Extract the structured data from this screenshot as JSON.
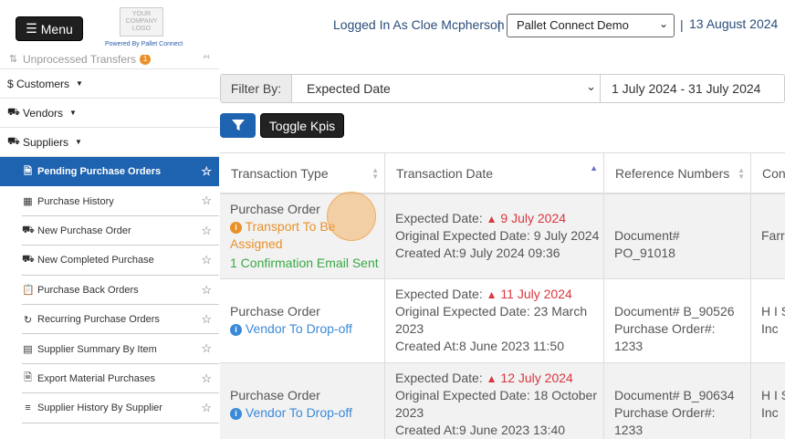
{
  "header": {
    "menu_label": "Menu",
    "logo_text": "YOUR COMPANY LOGO",
    "powered_by": "Powered By Pallet Connect",
    "logged_in": "Logged In As Cloe Mcpherson",
    "org_selected": "Pallet Connect Demo",
    "current_date": "13 August 2024"
  },
  "sidebar": {
    "top_partial": "Unprocessed Transfers",
    "top_badge": "1",
    "customers": "$ Customers",
    "vendors": "Vendors",
    "suppliers": "Suppliers",
    "items": [
      {
        "label": "Pending Purchase Orders",
        "icon": "file-icon",
        "active": true
      },
      {
        "label": "Purchase History",
        "icon": "table-icon"
      },
      {
        "label": "New Purchase Order",
        "icon": "truck-loading-icon"
      },
      {
        "label": "New Completed Purchase",
        "icon": "truck-icon"
      },
      {
        "label": "Purchase Back Orders",
        "icon": "clipboard-icon"
      },
      {
        "label": "Recurring Purchase Orders",
        "icon": "recycle-icon"
      },
      {
        "label": "Supplier Summary By Item",
        "icon": "pallet-icon"
      },
      {
        "label": "Export Material Purchases",
        "icon": "file-export-icon"
      },
      {
        "label": "Supplier History By Supplier",
        "icon": "chart-icon"
      }
    ]
  },
  "filter": {
    "label": "Filter By:",
    "selected": "Expected Date",
    "range": "1 July 2024 - 31 July 2024"
  },
  "toolbar": {
    "kpis_label": "Toggle Kpis"
  },
  "table": {
    "headers": [
      "Transaction Type",
      "Transaction Date",
      "Reference Numbers",
      "Cont"
    ],
    "rows": [
      {
        "type": "Purchase Order",
        "status": "Transport To Be",
        "status2": "Assigned",
        "extra": "1 Confirmation Email Sent",
        "expected_label": "Expected Date:",
        "expected": "9 July 2024",
        "original": "Original Expected Date: 9 July 2024",
        "original2": "",
        "created": "Created At:9 July 2024 09:36",
        "ref1": "Document#",
        "ref2": "PO_91018",
        "ref3": "",
        "contact": "Farre"
      },
      {
        "type": "Purchase Order",
        "status": "Vendor To Drop-off",
        "expected_label": "Expected Date:",
        "expected": "11 July 2024",
        "original": "Original Expected Date: 23 March",
        "original2": "2023",
        "created": "Created At:8 June 2023 11:50",
        "ref1": "Document# B_90526",
        "ref2": "Purchase Order#:",
        "ref3": "1233",
        "contact": "H I S",
        "contact2": "Inc"
      },
      {
        "type": "Purchase Order",
        "status": "Vendor To Drop-off",
        "expected_label": "Expected Date:",
        "expected": "12 July 2024",
        "original": "Original Expected Date: 18 October",
        "original2": "2023",
        "created": "Created At:9 June 2023 13:40",
        "ref1": "Document# B_90634",
        "ref2": "Purchase Order#:",
        "ref3": "1233",
        "contact": "H I S",
        "contact2": "Inc"
      }
    ]
  },
  "colors": {
    "accent": "#1e63b0",
    "warning": "#e8912a",
    "danger": "#d9363e",
    "success": "#3aa845",
    "info": "#3b8ad9"
  }
}
